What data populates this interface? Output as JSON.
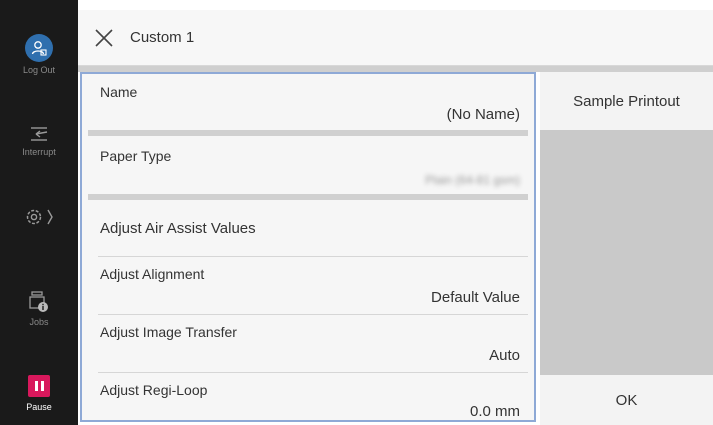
{
  "rail": {
    "logout_label": "Log Out",
    "interrupt_label": "Interrupt",
    "jobs_label": "Jobs",
    "pause_label": "Pause"
  },
  "header": {
    "title": "Custom 1"
  },
  "list": {
    "items": [
      {
        "name": "Name",
        "value": "(No Name)"
      },
      {
        "name": "Paper Type",
        "value": "Plain (64-81 gsm)"
      },
      {
        "name": "Adjust Air Assist Values",
        "value": ""
      },
      {
        "name": "Adjust Alignment",
        "value": "Default Value"
      },
      {
        "name": "Adjust Image Transfer",
        "value": "Auto"
      },
      {
        "name": "Adjust Regi-Loop",
        "value": "0.0 mm"
      }
    ]
  },
  "side": {
    "sample_label": "Sample Printout",
    "ok_label": "OK"
  },
  "colors": {
    "accent": "#2f6fae",
    "pause": "#d8185c",
    "focus_border": "#8ea9d6"
  }
}
